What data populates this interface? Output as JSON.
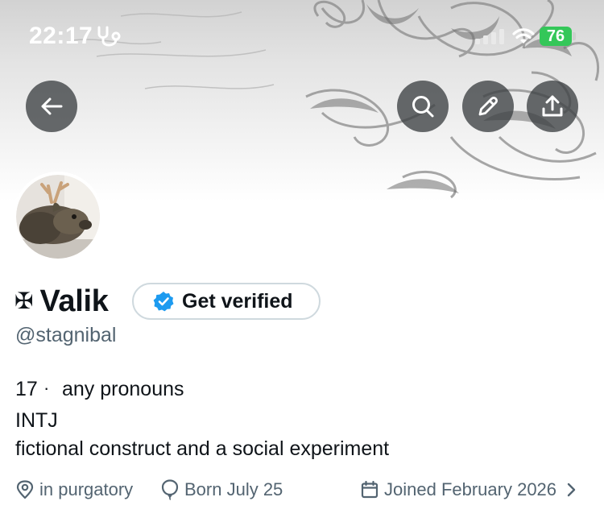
{
  "status_bar": {
    "time": "22:17",
    "battery": "76"
  },
  "profile": {
    "name_glyph": "✠",
    "display_name": "Valik",
    "verify_label": "Get verified",
    "handle": "@stagnibal",
    "bio": {
      "age": "17",
      "separator": "·",
      "pronouns": "any pronouns",
      "type": "INTJ",
      "description": "fictional construct and a social experiment"
    },
    "meta": {
      "location": "in purgatory",
      "birthday": "Born July 25",
      "joined": "Joined February 2026"
    }
  },
  "icons": {
    "status": [
      "stethoscope-icon",
      "signal-icon",
      "wifi-icon",
      "battery-icon"
    ],
    "header_buttons": [
      "back-arrow-icon",
      "search-icon",
      "pencil-icon",
      "share-icon"
    ],
    "meta": [
      "location-pin-icon",
      "balloon-icon",
      "calendar-icon",
      "chevron-right-icon"
    ]
  },
  "colors": {
    "verified_badge": "#1d9bf0",
    "battery_fill": "#34c759",
    "secondary_text": "#536471",
    "button_overlay": "#3c4043"
  }
}
